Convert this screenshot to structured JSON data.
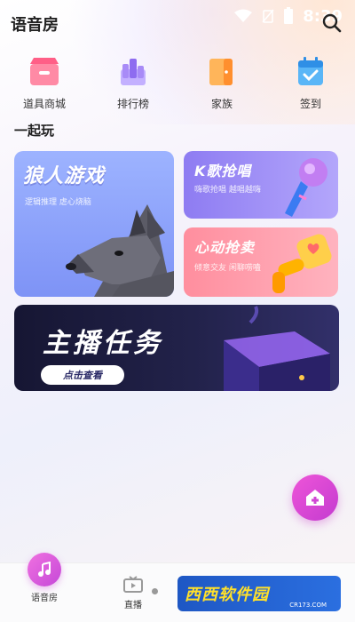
{
  "status_bar": {
    "time": "8:39"
  },
  "header": {
    "title": "语音房"
  },
  "quick_menu": [
    {
      "label": "道具商城",
      "icon": "shop-icon",
      "color": "#ff6f8e"
    },
    {
      "label": "排行榜",
      "icon": "ranking-icon",
      "color": "#9b7bf4"
    },
    {
      "label": "家族",
      "icon": "family-icon",
      "color": "#ffa23a"
    },
    {
      "label": "签到",
      "icon": "checkin-icon",
      "color": "#3aa0f0"
    }
  ],
  "section": {
    "title": "一起玩"
  },
  "cards": {
    "werewolf": {
      "title": "狼人游戏",
      "subtitle": "逻辑推理 虐心烧脑"
    },
    "ksong": {
      "title": "K歌抢唱",
      "subtitle": "嗨歌抢唱 越唱越嗨"
    },
    "heart": {
      "title": "心动抢卖",
      "subtitle": "倾意交友 闲聊唠嗑"
    },
    "task": {
      "title": "主播任务",
      "button": "点击查看"
    }
  },
  "bottom_nav": [
    {
      "label": "语音房",
      "icon": "music-note-icon"
    },
    {
      "label": "直播",
      "icon": "tv-icon"
    }
  ],
  "watermark": {
    "text": "西西软件园",
    "sub": "CR173.COM"
  },
  "colors": {
    "accent": "#d94cd6",
    "werewolf_bg": "#8ea2fb",
    "ksong_bg": "#9a8af5",
    "heart_bg": "#ff9fae",
    "task_bg": "#1c1c3d"
  }
}
